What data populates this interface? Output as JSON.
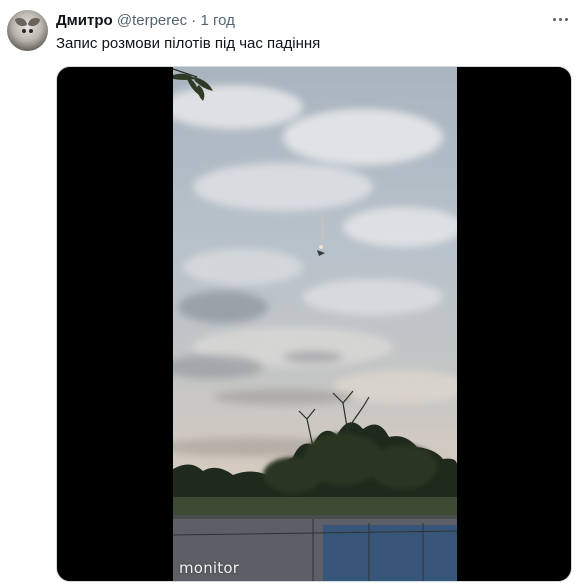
{
  "tweet": {
    "author_name": "Дмитро",
    "author_handle": "@terperec",
    "separator": "·",
    "timestamp": "1 год",
    "text": "Запис розмови пілотів під час падіння",
    "more_icon": "more-horizontal-icon"
  },
  "media": {
    "type": "video",
    "watermark": "monitor"
  },
  "colors": {
    "text_primary": "#0f1419",
    "text_secondary": "#536471",
    "media_background": "#000000"
  }
}
